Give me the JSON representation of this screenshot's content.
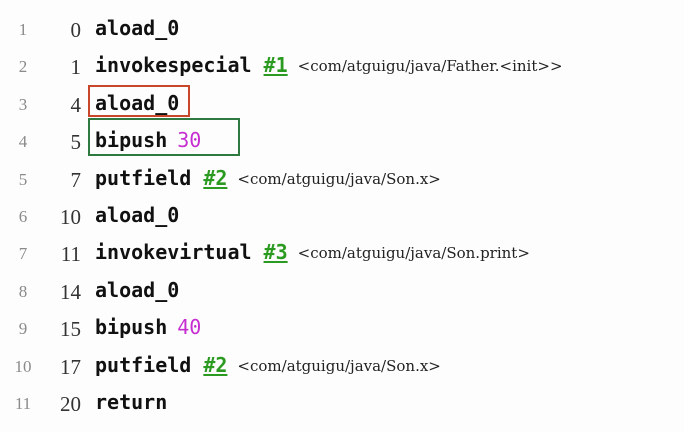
{
  "lines": [
    {
      "line_no": "1",
      "offset": "0",
      "opcode": "aload_0",
      "ref": "",
      "operand": "",
      "comment": ""
    },
    {
      "line_no": "2",
      "offset": "1",
      "opcode": "invokespecial",
      "ref": "#1",
      "operand": "",
      "comment": "<com/atguigu/java/Father.<init>>"
    },
    {
      "line_no": "3",
      "offset": "4",
      "opcode": "aload_0",
      "ref": "",
      "operand": "",
      "comment": ""
    },
    {
      "line_no": "4",
      "offset": "5",
      "opcode": "bipush",
      "ref": "",
      "operand": "30",
      "comment": ""
    },
    {
      "line_no": "5",
      "offset": "7",
      "opcode": "putfield",
      "ref": "#2",
      "operand": "",
      "comment": "<com/atguigu/java/Son.x>"
    },
    {
      "line_no": "6",
      "offset": "10",
      "opcode": "aload_0",
      "ref": "",
      "operand": "",
      "comment": ""
    },
    {
      "line_no": "7",
      "offset": "11",
      "opcode": "invokevirtual",
      "ref": "#3",
      "operand": "",
      "comment": "<com/atguigu/java/Son.print>"
    },
    {
      "line_no": "8",
      "offset": "14",
      "opcode": "aload_0",
      "ref": "",
      "operand": "",
      "comment": ""
    },
    {
      "line_no": "9",
      "offset": "15",
      "opcode": "bipush",
      "ref": "",
      "operand": "40",
      "comment": ""
    },
    {
      "line_no": "10",
      "offset": "17",
      "opcode": "putfield",
      "ref": "#2",
      "operand": "",
      "comment": "<com/atguigu/java/Son.x>"
    },
    {
      "line_no": "11",
      "offset": "20",
      "opcode": "return",
      "ref": "",
      "operand": "",
      "comment": ""
    }
  ],
  "highlights": [
    {
      "line_no": "3",
      "color": "#c8462a"
    },
    {
      "line_no": "4",
      "color": "#2f7a40"
    }
  ],
  "colors": {
    "ref_link": "#2a9a20",
    "int_operand": "#c62ed1",
    "line_number": "#8a8a8a"
  }
}
